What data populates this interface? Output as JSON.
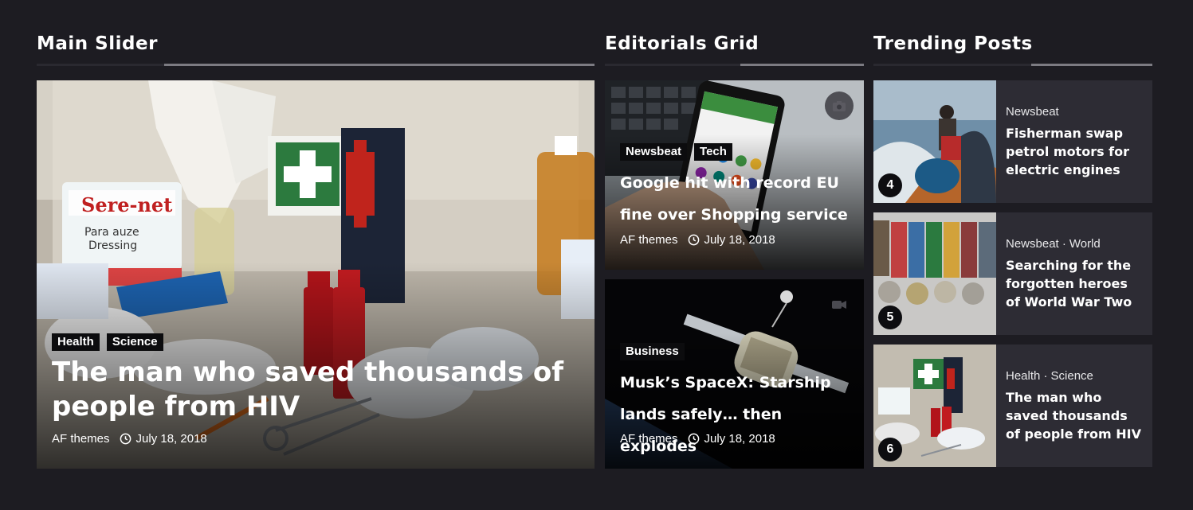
{
  "main_slider": {
    "heading": "Main Slider",
    "post": {
      "categories": [
        "Health",
        "Science"
      ],
      "title": "The man who saved thousands of people from HIV",
      "author": "AF themes",
      "date": "July 18, 2018"
    }
  },
  "editorials": {
    "heading": "Editorials Grid",
    "posts": [
      {
        "categories": [
          "Newsbeat",
          "Tech"
        ],
        "title": "Google hit with record EU fine over Shopping service",
        "author": "AF themes",
        "date": "July 18, 2018",
        "media_icon": "camera-icon"
      },
      {
        "categories": [
          "Business"
        ],
        "title": "Musk’s SpaceX: Starship lands safely… then explodes",
        "author": "AF themes",
        "date": "July 18, 2018",
        "media_icon": "video-icon"
      }
    ]
  },
  "trending": {
    "heading": "Trending Posts",
    "posts": [
      {
        "number": "4",
        "categories": [
          "Newsbeat"
        ],
        "title": "Fisherman swap petrol motors for electric engines"
      },
      {
        "number": "5",
        "categories": [
          "Newsbeat ·",
          "World"
        ],
        "title": "Searching for the forgotten heroes of World War Two"
      },
      {
        "number": "6",
        "categories": [
          "Health ·",
          "Science"
        ],
        "title": "The man who saved thousands of people from HIV"
      }
    ]
  },
  "colors": {
    "background": "#1d1c22",
    "card": "#2d2c34",
    "tag": "#0c0c0e",
    "divider": "#7c7b82"
  }
}
